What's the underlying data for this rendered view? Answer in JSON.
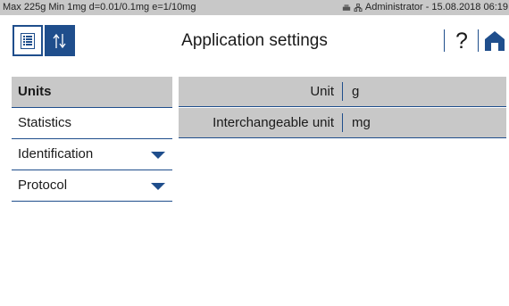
{
  "status_bar": {
    "balance_info": "Max 225g  Min 1mg  d=0.01/0.1mg  e=1/10mg",
    "user": "Administrator",
    "separator": "-",
    "datetime": "15.08.2018 06:19",
    "icons": [
      "printer-icon",
      "network-icon"
    ]
  },
  "header": {
    "title": "Application settings",
    "help_label": "?",
    "icons": [
      "list-icon",
      "up-down-arrows-icon",
      "home-icon"
    ]
  },
  "sidebar": {
    "items": [
      {
        "label": "Units",
        "active": true,
        "expandable": false
      },
      {
        "label": "Statistics",
        "active": false,
        "expandable": false
      },
      {
        "label": "Identification",
        "active": false,
        "expandable": true
      },
      {
        "label": "Protocol",
        "active": false,
        "expandable": true
      }
    ]
  },
  "settings": {
    "rows": [
      {
        "label": "Unit",
        "value": "g"
      },
      {
        "label": "Interchangeable unit",
        "value": "mg"
      }
    ]
  },
  "colors": {
    "accent": "#1f4e8c",
    "panel_gray": "#c8c8c8",
    "background": "#ffffff"
  }
}
